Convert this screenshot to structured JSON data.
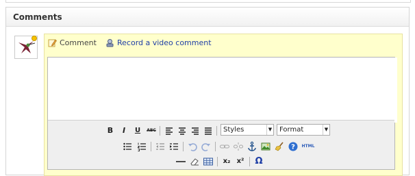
{
  "panel": {
    "title": "Comments"
  },
  "tabs": {
    "comment": "Comment",
    "video": "Record a video comment"
  },
  "editor": {
    "text": ""
  },
  "toolbar": {
    "bold": "B",
    "italic": "I",
    "underline": "U",
    "strike": "ABC",
    "styles": "Styles",
    "format": "Format",
    "html": "HTML",
    "omega": "Ω",
    "subscript": "x₂",
    "superscript": "x²"
  },
  "colors": {
    "comment_bg": "#ffffcc",
    "link": "#1f3fa6",
    "toolbar_bg": "#efefef"
  }
}
